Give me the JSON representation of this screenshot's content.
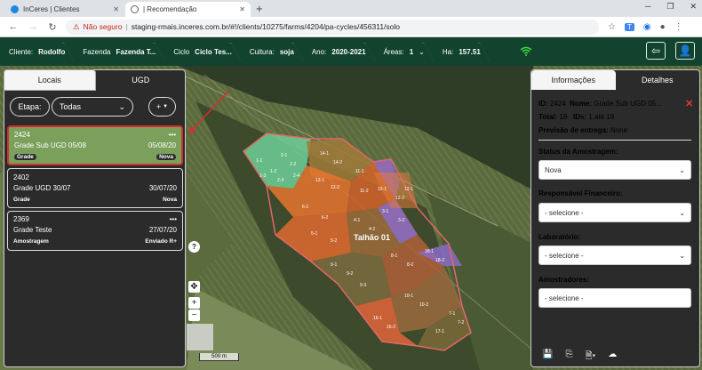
{
  "browser": {
    "tabs": [
      {
        "label": "InCeres | Clientes",
        "color": "#1e88e5"
      },
      {
        "label": "| Recomendação",
        "color": "#5f6368"
      }
    ],
    "security_label": "Não seguro",
    "url": "staging-rmais.inceres.com.br/#!/clients/10275/farms/4204/pa-cycles/456311/solo",
    "ext_label": "T"
  },
  "header": {
    "cliente_label": "Cliente:",
    "cliente_value": "Rodolfo",
    "fazenda_label": "Fazenda",
    "fazenda_value": "Fazenda T...",
    "ciclo_label": "Ciclo",
    "ciclo_value": "Ciclo Tes...",
    "cultura_label": "Cultura:",
    "cultura_value": "soja",
    "ano_label": "Ano:",
    "ano_value": "2020-2021",
    "areas_label": "Áreas:",
    "areas_value": "1",
    "ha_label": "Ha:",
    "ha_value": "157.51",
    "brand_color": "#11432f"
  },
  "left_panel": {
    "tabs": [
      "Locais",
      "UGD"
    ],
    "etapa_label": "Etapa:",
    "etapa_value": "Todas",
    "add_label": "+",
    "cards": [
      {
        "id": "2424",
        "name": "Grade Sub UGD 05/08",
        "date": "05/08/20",
        "type": "Grade",
        "status": "Nova",
        "selected": true
      },
      {
        "id": "2402",
        "name": "Grade UGD 30/07",
        "date": "30/07/20",
        "type": "Grade",
        "status": "Nova",
        "selected": false
      },
      {
        "id": "2369",
        "name": "Grade Teste",
        "date": "27/07/20",
        "type": "Amostragem",
        "status": "Enviado R+",
        "selected": false
      }
    ]
  },
  "map": {
    "field_label": "Talhão 01",
    "scale_label": "500 m",
    "help_label": "?",
    "zoom_in": "+",
    "zoom_out": "−",
    "zone_labels": [
      "1-1",
      "1-2",
      "1-3",
      "2-1",
      "2-2",
      "2-3",
      "2-4",
      "14-1",
      "14-2",
      "13-1",
      "13-2",
      "11-1",
      "11-2",
      "6-1",
      "6-2",
      "5-1",
      "5-2",
      "4-1",
      "4-2",
      "3-1",
      "3-2",
      "9-1",
      "9-2",
      "9-3",
      "8-1",
      "8-2",
      "18-1",
      "18-2",
      "10-1",
      "10-2",
      "16-1",
      "16-2",
      "17-1",
      "15-1",
      "12-1",
      "12-2",
      "7-1",
      "7-2"
    ]
  },
  "right_panel": {
    "tabs": [
      "Informações",
      "Detalhes"
    ],
    "id_label": "ID:",
    "id_value": "2424",
    "nome_label": "Nome:",
    "nome_value": "Grade Sub UGD 05...",
    "total_label": "Total:",
    "total_value": "18",
    "ids_label": "IDs:",
    "ids_value": "1 até 18",
    "previsao_label": "Previsão de entrega:",
    "previsao_value": "None",
    "status_label": "Status da Amostragem:",
    "status_value": "Nova",
    "resp_label": "Responsável Financeiro:",
    "resp_value": "- selecione -",
    "lab_label": "Laboratório:",
    "lab_value": "- selecione -",
    "amos_label": "Amostradores:",
    "amos_value": "- selecione -"
  }
}
